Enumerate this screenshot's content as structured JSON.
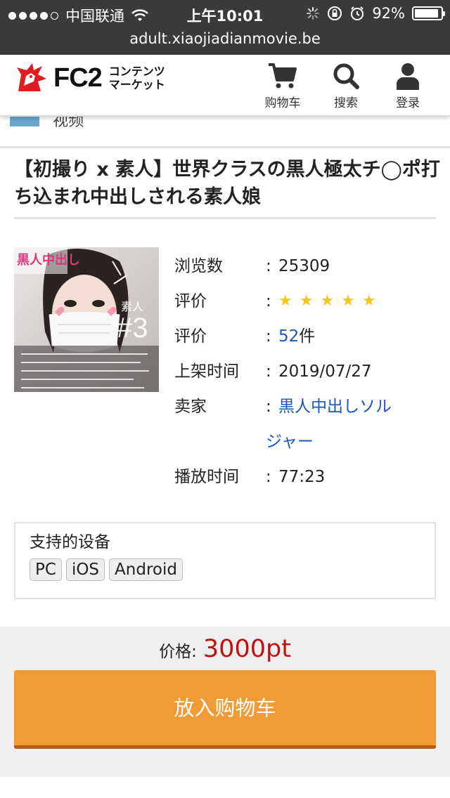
{
  "status_bar": {
    "carrier": "中国联通",
    "time": "上午10:01",
    "battery": "92%",
    "battery_level": 0.92
  },
  "url": "adult.xiaojiadianmovie.be",
  "header": {
    "logo_text": "FC2",
    "logo_sub_line1": "コンテンツ",
    "logo_sub_line2": "マーケット",
    "cart_label": "购物车",
    "search_label": "搜索",
    "login_label": "登录"
  },
  "peek_label": "视频",
  "product": {
    "title": "【初撮り x 素人】世界クラスの黒人極太チ◯ポ打ち込まれ中出しされる素人娘",
    "thumbnail": {
      "title_text": "黒人中出し",
      "number": "#3",
      "side_text": "素人"
    },
    "info": {
      "views_label": "浏览数",
      "views_value": "25309",
      "rating_label": "评价",
      "rating_stars": "★★★★★",
      "reviews_label": "评价",
      "reviews_count": "52",
      "reviews_unit": "件",
      "date_label": "上架时间",
      "date_value": "2019/07/27",
      "seller_label": "卖家",
      "seller_value_line1": "黒人中出しソル",
      "seller_value_line2": "ジャー",
      "duration_label": "播放时间",
      "duration_value": "77:23",
      "colon": ":"
    }
  },
  "devices": {
    "title": "支持的设备",
    "items": [
      "PC",
      "iOS",
      "Android"
    ]
  },
  "purchase": {
    "price_label": "价格:",
    "price_value": "3000pt",
    "button_label": "放入购物车"
  },
  "colors": {
    "accent_orange": "#f19b36",
    "price_red": "#c01010",
    "link_blue": "#1a55c2",
    "star_yellow": "#f3c61f",
    "status_bar": "#3a3a3a"
  }
}
